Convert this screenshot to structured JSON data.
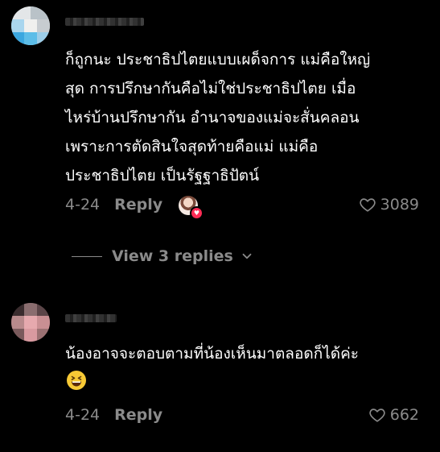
{
  "comments": [
    {
      "text": "ก็ถูกนะ ประชาธิปไตยแบบเผด็จการ แม่คือใหญ่\nสุด การปรึกษากันคือไม่ใช่ประชาธิปไตย เมื่อ\nไหร่บ้านปรึกษากัน อำนาจของแม่จะสั่นคลอน\nเพราะการตัดสินใจสุดท้ายคือแม่ แม่คือ\nประชาธิปไตย เป็นรัฐฐาธิปัตน์",
      "date": "4-24",
      "reply_label": "Reply",
      "likes": "3089",
      "view_replies_label": "View 3 replies"
    },
    {
      "text": "น้องอาจจะตอบตามที่น้องเห็นมาตลอดก็ได้ค่ะ",
      "date": "4-24",
      "reply_label": "Reply",
      "likes": "662",
      "emoji": "grinning-squinting-face"
    }
  ]
}
